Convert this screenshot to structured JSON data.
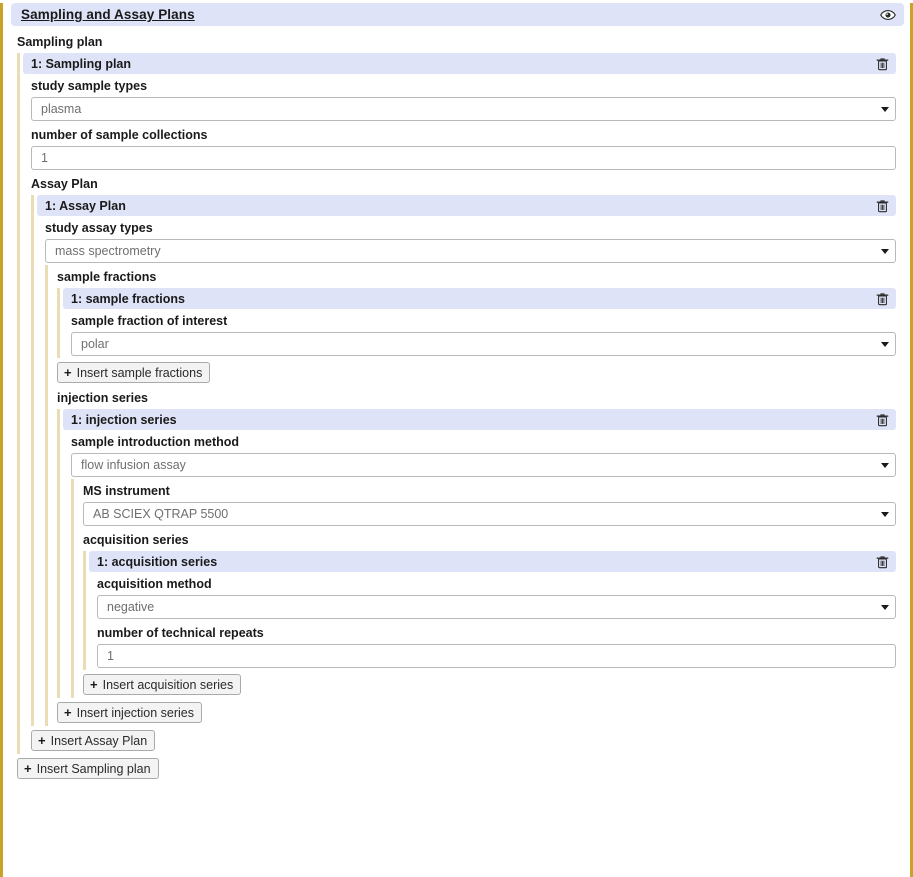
{
  "panel": {
    "title": "Sampling and Assay Plans",
    "eye_icon": "eye-icon",
    "accent_border": "#c9a227",
    "header_bg": "#dfe3f7"
  },
  "icons": {
    "trash": "trash-icon",
    "plus": "+",
    "caret": "chevron-down-icon"
  },
  "sampling_plan": {
    "group_label": "Sampling plan",
    "item_title": "1: Sampling plan",
    "fields": {
      "study_sample_types": {
        "label": "study sample types",
        "value": "plasma",
        "type": "select"
      },
      "number_of_sample_collections": {
        "label": "number of sample collections",
        "value": "1",
        "type": "text"
      }
    },
    "insert_label": "Insert Sampling plan"
  },
  "assay_plan": {
    "group_label": "Assay Plan",
    "item_title": "1: Assay Plan",
    "fields": {
      "study_assay_types": {
        "label": "study assay types",
        "value": "mass spectrometry",
        "type": "select"
      }
    },
    "insert_label": "Insert Assay Plan"
  },
  "sample_fractions": {
    "group_label": "sample fractions",
    "item_title": "1: sample fractions",
    "fields": {
      "sample_fraction_of_interest": {
        "label": "sample fraction of interest",
        "value": "polar",
        "type": "select"
      }
    },
    "insert_label": "Insert sample fractions"
  },
  "injection_series": {
    "group_label": "injection series",
    "item_title": "1: injection series",
    "fields": {
      "sample_introduction_method": {
        "label": "sample introduction method",
        "value": "flow infusion assay",
        "type": "select"
      },
      "ms_instrument": {
        "label": "MS instrument",
        "value": "AB SCIEX QTRAP 5500",
        "type": "select"
      }
    },
    "insert_label": "Insert injection series"
  },
  "acquisition_series": {
    "group_label": "acquisition series",
    "item_title": "1: acquisition series",
    "fields": {
      "acquisition_method": {
        "label": "acquisition method",
        "value": "negative",
        "type": "select"
      },
      "number_of_technical_repeats": {
        "label": "number of technical repeats",
        "value": "1",
        "type": "text"
      }
    },
    "insert_label": "Insert acquisition series"
  }
}
